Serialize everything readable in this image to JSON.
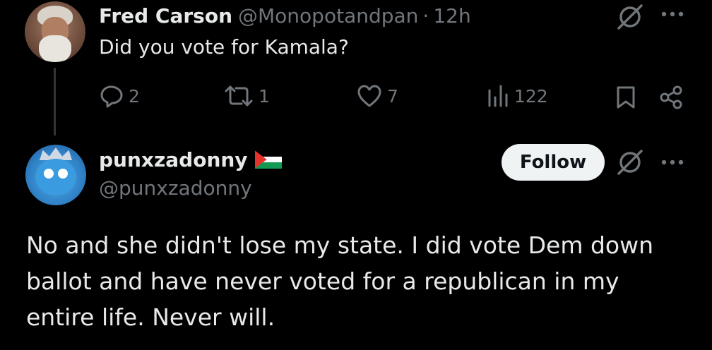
{
  "tweet_1": {
    "display_name": "Fred Carson",
    "handle": "@Monopotandpan",
    "separator": "·",
    "time": "12h",
    "text": "Did you vote for Kamala?",
    "actions": {
      "replies": "2",
      "reposts": "1",
      "likes": "7",
      "views": "122"
    }
  },
  "tweet_2": {
    "display_name": "punxzadonny",
    "handle": "@punxzadonny",
    "follow_label": "Follow",
    "text": "No and she didn't lose my state. I did vote Dem down ballot and have never voted for a republican in my entire life. Never will."
  },
  "icons": {
    "grok": "grok-icon",
    "more": "more-icon",
    "reply": "reply-icon",
    "repost": "repost-icon",
    "like": "heart-icon",
    "views": "views-icon",
    "bookmark": "bookmark-icon",
    "share": "share-icon",
    "flag": "palestine-flag-icon"
  },
  "colors": {
    "background": "#000000",
    "text_primary": "#e7e9ea",
    "text_secondary": "#71767b",
    "follow_bg": "#eff3f4",
    "follow_text": "#0f1419",
    "thread_line": "#333639"
  }
}
